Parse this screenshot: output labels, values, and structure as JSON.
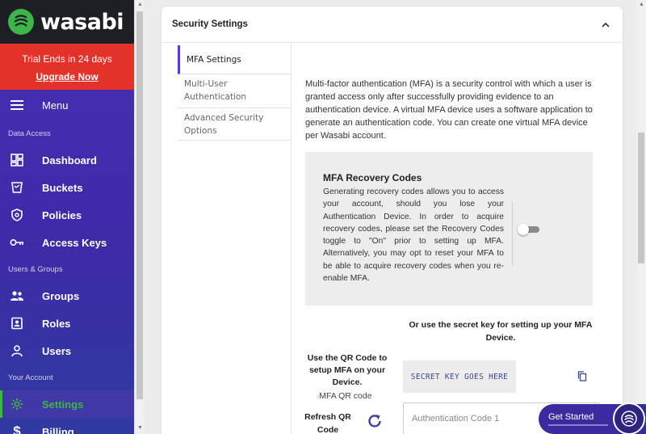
{
  "brand": {
    "name": "wasabi"
  },
  "trial": {
    "text": "Trial Ends in 24 days",
    "upgrade_label": "Upgrade Now"
  },
  "sidebar": {
    "menu_label": "Menu",
    "sections": {
      "data_access": "Data Access",
      "users_groups": "Users & Groups",
      "your_account": "Your Account"
    },
    "items": {
      "dashboard": "Dashboard",
      "buckets": "Buckets",
      "policies": "Policies",
      "access_keys": "Access Keys",
      "groups": "Groups",
      "roles": "Roles",
      "users": "Users",
      "settings": "Settings",
      "billing": "Billing"
    }
  },
  "panel": {
    "title": "Security Settings",
    "tabs": [
      "MFA Settings",
      "Multi-User Authentication",
      "Advanced Security Options"
    ],
    "description": "Multi-factor authentication (MFA) is a security control with which a user is granted access only after successfully providing evidence to an authentication device. A virtual MFA device uses a software application to generate an authentication code. You can create one virtual MFA device per Wasabi account.",
    "recovery": {
      "title": "MFA Recovery Codes",
      "text": "Generating recovery codes allows you to access your account, should you lose your Authentication Device. In order to acquire recovery codes, please set the Recovery Codes toggle to \"On\" prior to setting up MFA. Alternatively, you may opt to reset your MFA to be able to acquire recovery codes when you re-enable MFA.",
      "toggle_on": false
    },
    "secret": {
      "title": "Or use the secret key for setting up your MFA Device.",
      "key": "SECRET KEY GOES HERE"
    },
    "qr": {
      "title": "Use the QR Code to setup MFA on your Device.",
      "image_alt": "MFA QR code",
      "refresh_label": "Refresh QR Code"
    },
    "auth_code": {
      "placeholder": "Authentication Code 1"
    }
  },
  "get_started": {
    "label": "Get Started"
  },
  "colors": {
    "accent": "#5b3cc4",
    "active_green": "#3cb54a",
    "trial_red": "#e4322b"
  }
}
